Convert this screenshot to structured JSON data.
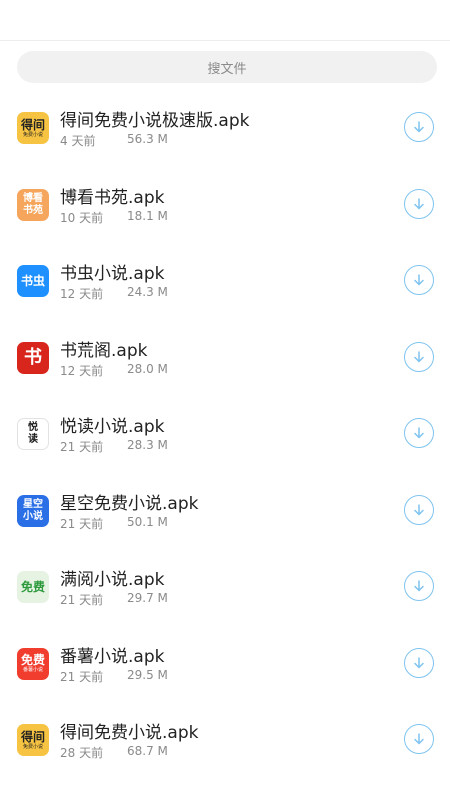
{
  "search": {
    "placeholder": "搜文件"
  },
  "files": [
    {
      "name": "得间免费小说极速版.apk",
      "time": "4 天前",
      "size": "56.3 M",
      "icon": "dejian-icon",
      "icon_text": "得间",
      "icon_sub": "免费小说",
      "bg": "#f6c342",
      "fg": "#222222",
      "style": "yellow"
    },
    {
      "name": "博看书苑.apk",
      "time": "10 天前",
      "size": "18.1 M",
      "icon": "bokan-icon",
      "icon_text": "博看\n书苑",
      "bg": "#f5a55c",
      "fg": "#ffffff",
      "style": "orange"
    },
    {
      "name": "书虫小说.apk",
      "time": "12 天前",
      "size": "24.3 M",
      "icon": "shuchong-icon",
      "icon_text": "书虫",
      "bg": "#1e90ff",
      "fg": "#ffffff",
      "style": "blue"
    },
    {
      "name": "书荒阁.apk",
      "time": "12 天前",
      "size": "28.0 M",
      "icon": "shuhuangge-icon",
      "icon_text": "书",
      "bg": "#d8261d",
      "fg": "#ffffff",
      "style": "red"
    },
    {
      "name": "悦读小说.apk",
      "time": "21 天前",
      "size": "28.3 M",
      "icon": "yuedu-icon",
      "icon_text": "悦\n读",
      "bg": "#ffffff",
      "fg": "#222222",
      "style": "white"
    },
    {
      "name": "星空免费小说.apk",
      "time": "21 天前",
      "size": "50.1 M",
      "icon": "xingkong-icon",
      "icon_text": "星空\n小说",
      "bg": "#2a6fe6",
      "fg": "#ffffff",
      "style": "blue2"
    },
    {
      "name": "满阅小说.apk",
      "time": "21 天前",
      "size": "29.7 M",
      "icon": "manyue-icon",
      "icon_text": "免费",
      "bg": "#e6f3e3",
      "fg": "#2e9a3c",
      "style": "green"
    },
    {
      "name": "番薯小说.apk",
      "time": "21 天前",
      "size": "29.5 M",
      "icon": "fanshu-icon",
      "icon_text": "免费",
      "icon_sub": "番薯小说",
      "bg": "#f03d2e",
      "fg": "#ffffff",
      "style": "red2"
    },
    {
      "name": "得间免费小说.apk",
      "time": "28 天前",
      "size": "68.7 M",
      "icon": "dejian-icon",
      "icon_text": "得间",
      "icon_sub": "免费小说",
      "bg": "#f6c342",
      "fg": "#222222",
      "style": "yellow"
    }
  ],
  "colors": {
    "accent": "#7fc4ef",
    "text": "#222222",
    "muted": "#8a8a8a"
  }
}
